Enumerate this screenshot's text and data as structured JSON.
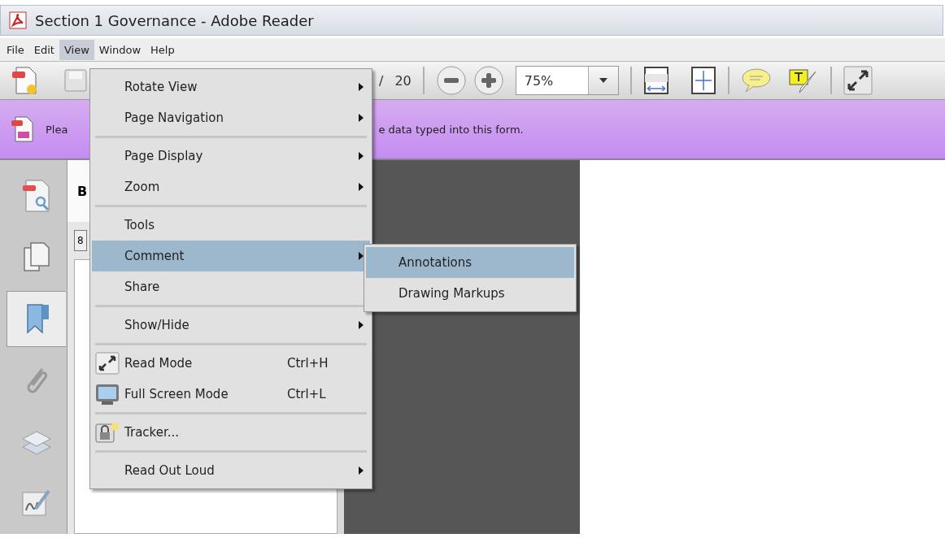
{
  "window": {
    "title": "Section 1 Governance - Adobe Reader"
  },
  "menu_bar": [
    {
      "label": "File",
      "selected": false
    },
    {
      "label": "Edit",
      "selected": false
    },
    {
      "label": "View",
      "selected": true
    },
    {
      "label": "Window",
      "selected": false
    },
    {
      "label": "Help",
      "selected": false
    }
  ],
  "toolbar": {
    "page_separator": "/",
    "page_total": "20",
    "zoom": "75%"
  },
  "notification": {
    "text_start": "Plea",
    "text_end": "e data typed into this form."
  },
  "side_tabs": [
    {
      "kind": "document",
      "selected": false
    },
    {
      "kind": "pages",
      "selected": false
    },
    {
      "kind": "bookmarks",
      "selected": true
    },
    {
      "kind": "attachments",
      "selected": false
    },
    {
      "kind": "layers",
      "selected": false
    },
    {
      "kind": "signatures",
      "selected": false
    }
  ],
  "bookmarks_panel": {
    "title": "B",
    "button": "8"
  },
  "view_menu": [
    {
      "kind": "item",
      "label": "Rotate View",
      "submenu": true,
      "selected": false
    },
    {
      "kind": "item",
      "label": "Page Navigation",
      "submenu": true,
      "selected": false
    },
    {
      "kind": "separator"
    },
    {
      "kind": "item",
      "label": "Page Display",
      "submenu": true,
      "selected": false
    },
    {
      "kind": "item",
      "label": "Zoom",
      "submenu": true,
      "selected": false
    },
    {
      "kind": "separator"
    },
    {
      "kind": "item",
      "label": "Tools",
      "submenu": false,
      "selected": false
    },
    {
      "kind": "item",
      "label": "Comment",
      "submenu": true,
      "selected": true
    },
    {
      "kind": "item",
      "label": "Share",
      "submenu": false,
      "selected": false
    },
    {
      "kind": "separator"
    },
    {
      "kind": "item",
      "label": "Show/Hide",
      "submenu": true,
      "selected": false
    },
    {
      "kind": "separator"
    },
    {
      "kind": "icon_item",
      "label": "Read Mode",
      "shortcut": "Ctrl+H",
      "submenu": false,
      "selected": false
    },
    {
      "kind": "icon_item",
      "label": "Full Screen Mode",
      "shortcut": "Ctrl+L",
      "submenu": false,
      "selected": false
    },
    {
      "kind": "separator"
    },
    {
      "kind": "icon_item",
      "label": "Tracker...",
      "submenu": false,
      "selected": false
    },
    {
      "kind": "separator"
    },
    {
      "kind": "item",
      "label": "Read Out Loud",
      "submenu": true,
      "selected": false
    }
  ],
  "comment_submenu": [
    {
      "kind": "item",
      "label": "Annotations",
      "selected": true
    },
    {
      "kind": "item",
      "label": "Drawing Markups",
      "selected": false
    }
  ]
}
